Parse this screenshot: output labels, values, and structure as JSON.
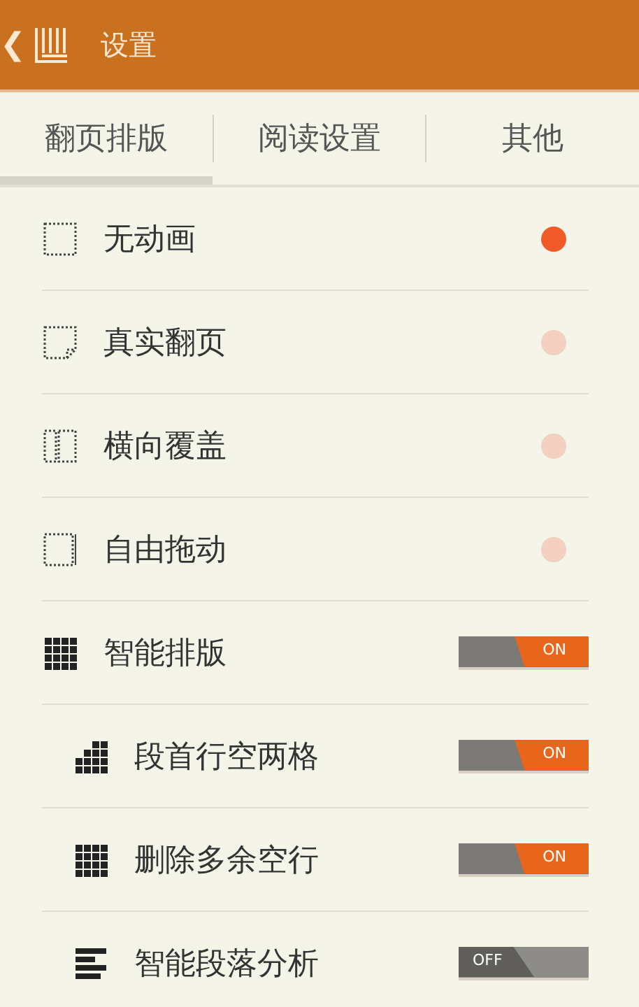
{
  "header": {
    "back": "❮",
    "title": "设置"
  },
  "tabs": [
    {
      "label": "翻页排版",
      "selected": true
    },
    {
      "label": "阅读设置",
      "selected": false
    },
    {
      "label": "其他",
      "selected": false
    }
  ],
  "items": [
    {
      "kind": "radio",
      "label": "无动画",
      "selected": true
    },
    {
      "kind": "radio",
      "label": "真实翻页",
      "selected": false
    },
    {
      "kind": "radio",
      "label": "横向覆盖",
      "selected": false
    },
    {
      "kind": "radio",
      "label": "自由拖动",
      "selected": false
    },
    {
      "kind": "toggle",
      "label": "智能排版",
      "on": true,
      "state_label": "ON",
      "children": [
        {
          "kind": "toggle",
          "label": "段首行空两格",
          "on": true,
          "state_label": "ON"
        },
        {
          "kind": "toggle",
          "label": "删除多余空行",
          "on": true,
          "state_label": "ON"
        },
        {
          "kind": "toggle",
          "label": "智能段落分析",
          "on": false,
          "state_label": "OFF"
        }
      ]
    }
  ]
}
